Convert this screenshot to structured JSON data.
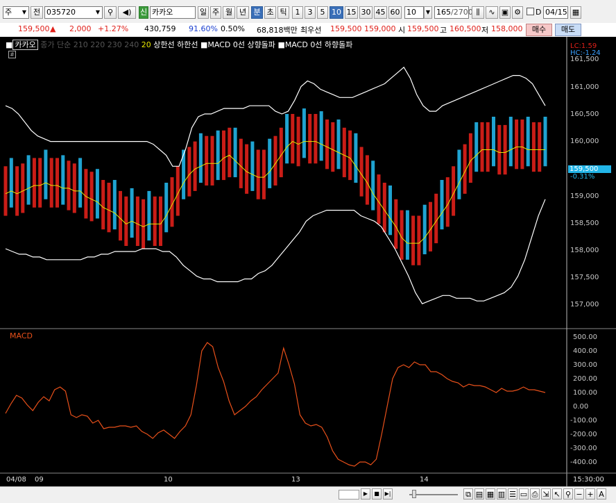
{
  "toolbar": {
    "period_select": "주",
    "prev_label": "전",
    "code": "035720",
    "new_badge": "신",
    "stock_name": "카카오",
    "period_buttons": [
      "일",
      "주",
      "월",
      "년",
      "분",
      "초",
      "틱"
    ],
    "active_period": "분",
    "minute_buttons": [
      "1",
      "3",
      "5",
      "10",
      "15",
      "30",
      "45",
      "60"
    ],
    "active_minute": "10",
    "count_value": "10",
    "range_value": "165",
    "range_total": "/2700",
    "d_label": "D",
    "date_value": "04/15"
  },
  "quote": {
    "price": "159,500",
    "arrow": "▲",
    "change": "2,000",
    "change_pct": "+1.27%",
    "volume": "430,759",
    "vol_ratio": "91.60%",
    "turnover": "0.50%",
    "amount": "68,818백만",
    "best_label": "최우선",
    "best_ask": "159,500",
    "best_bid": "159,000",
    "open_label": "시",
    "open": "159,500",
    "high_label": "고",
    "high": "160,500",
    "low_label": "저",
    "low": "158,000",
    "buy_button": "매수",
    "sell_button": "매도"
  },
  "legend": {
    "name": "카카오",
    "ma_text": "종가 단순 210 220 230 240",
    "ma20": "20",
    "bb": "상한선 하한선",
    "sig1": "MACD 0선 상향돌파",
    "sig2": "MACD 0선 하향돌파"
  },
  "price_axis": {
    "lc": "LC:1.59",
    "hc": "HC:-1.24",
    "ticks": [
      "161,500",
      "161,000",
      "160,500",
      "160,000",
      "159,000",
      "158,500",
      "158,000",
      "157,500",
      "157,000"
    ],
    "current": "159,500",
    "current_pct": "-0.31%"
  },
  "macd_panel": {
    "title": "MACD",
    "ticks": [
      "500.00",
      "400.00",
      "300.00",
      "200.00",
      "100.00",
      "0.00",
      "-100.00",
      "-200.00",
      "-300.00",
      "-400.00"
    ]
  },
  "time_axis": {
    "labels": [
      "04/08",
      "09",
      "10",
      "13",
      "14"
    ],
    "last": "15:30:00"
  },
  "colors": {
    "up": "#e0201a",
    "down": "#22b5e8",
    "ma20": "#e8e800",
    "bands": "#ffffff",
    "macd": "#e8501a"
  },
  "chart_data": {
    "type": "line",
    "title": "",
    "price_ylim": [
      156800,
      161600
    ],
    "macd_ylim": [
      -450,
      500
    ],
    "macd_series_name": "MACD",
    "macd_values": [
      -50,
      20,
      80,
      60,
      10,
      -30,
      30,
      70,
      40,
      120,
      140,
      110,
      -60,
      -80,
      -60,
      -70,
      -120,
      -100,
      -160,
      -150,
      -150,
      -140,
      -140,
      -150,
      -140,
      -180,
      -200,
      -230,
      -190,
      -170,
      -200,
      -230,
      -180,
      -140,
      -60,
      150,
      400,
      460,
      430,
      280,
      180,
      40,
      -60,
      -30,
      0,
      40,
      70,
      120,
      160,
      200,
      240,
      420,
      300,
      160,
      -60,
      -120,
      -140,
      -130,
      -150,
      -220,
      -320,
      -380,
      -400,
      -420,
      -430,
      -400,
      -400,
      -420,
      -380,
      -200,
      0,
      200,
      280,
      300,
      280,
      320,
      300,
      300,
      250,
      250,
      230,
      200,
      180,
      170,
      140,
      160,
      150,
      150,
      140,
      120,
      100,
      130,
      110,
      110,
      120,
      140,
      120,
      120,
      110,
      100
    ],
    "ma20_values": [
      159000,
      159050,
      159000,
      159050,
      159100,
      159150,
      159150,
      159200,
      159150,
      159150,
      159100,
      159100,
      159050,
      159050,
      158950,
      158900,
      158850,
      158750,
      158700,
      158650,
      158550,
      158450,
      158500,
      158450,
      158400,
      158450,
      158450,
      158450,
      158600,
      158800,
      159000,
      159200,
      159350,
      159450,
      159500,
      159550,
      159550,
      159550,
      159650,
      159700,
      159600,
      159500,
      159400,
      159350,
      159300,
      159300,
      159400,
      159550,
      159700,
      159850,
      159950,
      159900,
      159950,
      159950,
      159950,
      159900,
      159850,
      159800,
      159750,
      159700,
      159650,
      159500,
      159350,
      159200,
      159000,
      158850,
      158700,
      158550,
      158400,
      158200,
      158100,
      158100,
      158100,
      158200,
      158350,
      158500,
      158650,
      158800,
      159000,
      159200,
      159400,
      159600,
      159700,
      159800,
      159800,
      159800,
      159750,
      159750,
      159800,
      159850,
      159850,
      159800,
      159800,
      159800,
      159800
    ],
    "upper_band": [
      160600,
      160550,
      160450,
      160300,
      160150,
      160050,
      160000,
      159950,
      159950,
      159950,
      159950,
      159950,
      159950,
      159950,
      159950,
      159950,
      159950,
      159950,
      159950,
      159950,
      159950,
      159950,
      159950,
      159900,
      159800,
      159700,
      159500,
      159500,
      159800,
      160200,
      160400,
      160450,
      160450,
      160500,
      160550,
      160550,
      160550,
      160550,
      160600,
      160600,
      160600,
      160600,
      160500,
      160450,
      160500,
      160700,
      160950,
      161050,
      161000,
      160900,
      160850,
      160800,
      160750,
      160750,
      160750,
      160800,
      160850,
      160900,
      160950,
      161000,
      161100,
      161200,
      161300,
      161100,
      160800,
      160600,
      160500,
      160500,
      160600,
      160650,
      160700,
      160750,
      160800,
      160850,
      160900,
      160950,
      161000,
      161050,
      161100,
      161150,
      161150,
      161100,
      161000,
      160800,
      160600
    ],
    "lower_band": [
      158000,
      157950,
      157900,
      157900,
      157850,
      157850,
      157800,
      157800,
      157800,
      157800,
      157800,
      157800,
      157850,
      157850,
      157900,
      157900,
      157950,
      157950,
      157950,
      157950,
      158000,
      158000,
      158000,
      157950,
      157950,
      157850,
      157700,
      157600,
      157500,
      157450,
      157450,
      157400,
      157400,
      157400,
      157400,
      157450,
      157450,
      157550,
      157600,
      157700,
      157850,
      158000,
      158150,
      158300,
      158500,
      158600,
      158650,
      158700,
      158700,
      158700,
      158700,
      158700,
      158600,
      158550,
      158500,
      158400,
      158200,
      158000,
      157750,
      157500,
      157200,
      157000,
      157050,
      157100,
      157150,
      157150,
      157100,
      157100,
      157100,
      157050,
      157050,
      157100,
      157150,
      157200,
      157300,
      157500,
      157800,
      158200,
      158600,
      158900
    ]
  }
}
